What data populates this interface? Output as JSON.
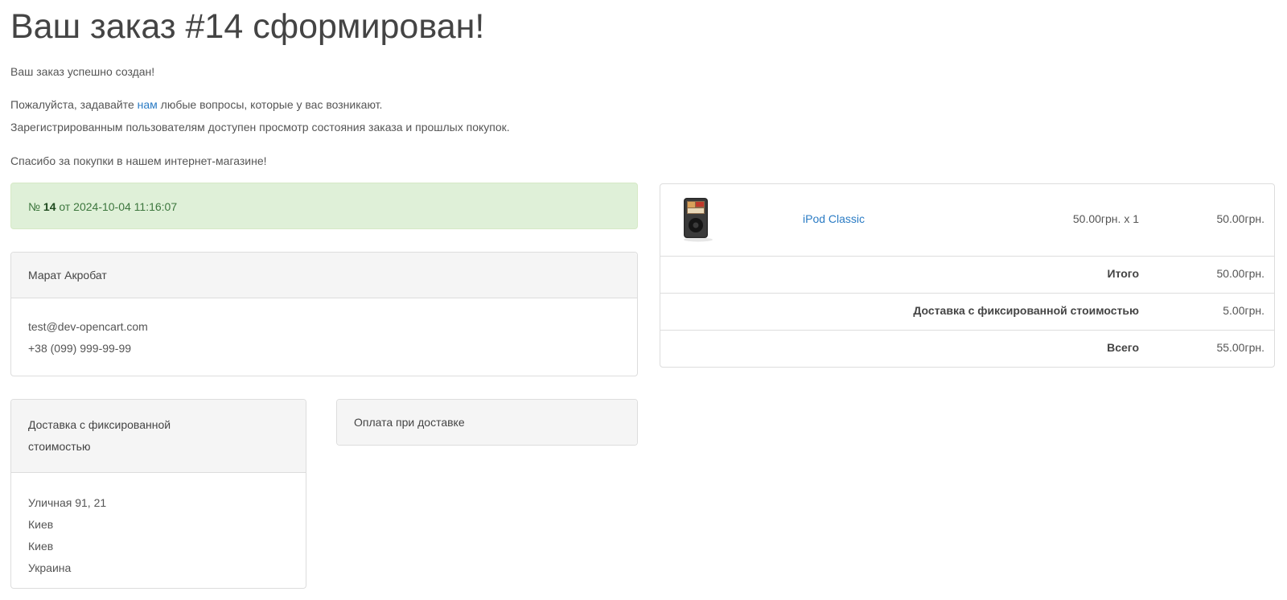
{
  "page": {
    "title": "Ваш заказ #14 сформирован!",
    "success_text": "Ваш заказ успешно создан!",
    "questions_prefix": "Пожалуйста, задавайте ",
    "questions_link": "нам",
    "questions_suffix": " любые вопросы, которые у вас возникают.",
    "registered_text": "Зарегистрированным пользователям доступен просмотр состояния заказа и прошлых покупок.",
    "thanks_text": "Спасибо за покупки в нашем интернет-магазине!"
  },
  "order": {
    "number_prefix": "№ ",
    "number": "14",
    "date_prefix": " от ",
    "date": "2024-10-04 11:16:07"
  },
  "customer": {
    "name": "Марат Акробат",
    "email": "test@dev-opencart.com",
    "phone": "+38 (099) 999-99-99"
  },
  "shipping": {
    "method_line1": "Доставка с фиксированной",
    "method_line2": "стоимостью",
    "address_line1": "Уличная 91, 21",
    "address_line2": "Киев",
    "address_line3": "Киев",
    "address_line4": "Украина"
  },
  "payment": {
    "method": "Оплата при доставке"
  },
  "cart": {
    "items": [
      {
        "name": "iPod Classic",
        "price_qty": "50.00грн. x 1",
        "total": "50.00грн."
      }
    ],
    "totals": [
      {
        "label": "Итого",
        "value": "50.00грн."
      },
      {
        "label": "Доставка с фиксированной стоимостью",
        "value": "5.00грн."
      },
      {
        "label": "Всего",
        "value": "55.00грн."
      }
    ]
  }
}
